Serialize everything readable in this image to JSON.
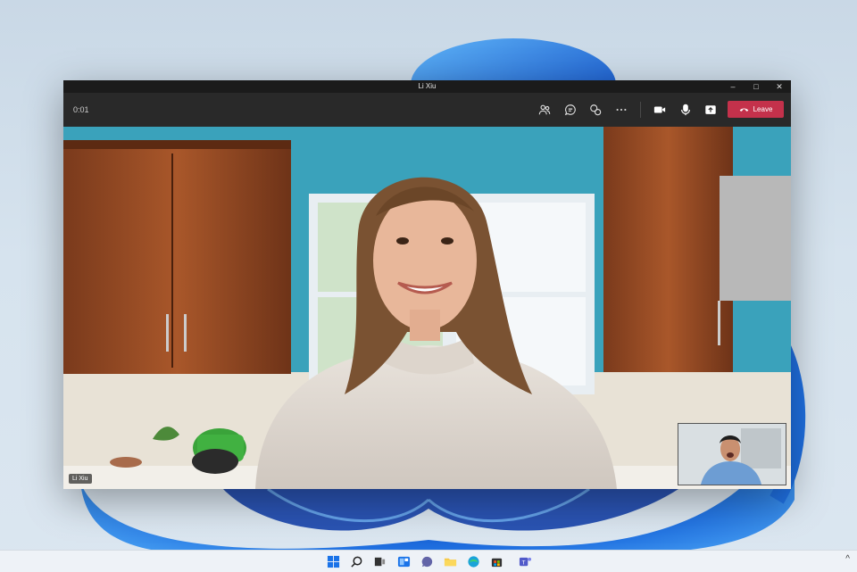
{
  "window": {
    "title": "Li Xiu",
    "minimize_glyph": "–",
    "maximize_glyph": "□",
    "close_glyph": "✕"
  },
  "toolbar": {
    "timer": "0:01",
    "buttons": [
      {
        "name": "participants",
        "icon": "people-icon"
      },
      {
        "name": "chat",
        "icon": "chat-icon"
      },
      {
        "name": "reactions",
        "icon": "reactions-icon"
      },
      {
        "name": "more",
        "icon": "more-icon"
      },
      {
        "name": "camera",
        "icon": "camera-icon"
      },
      {
        "name": "mic",
        "icon": "mic-icon"
      },
      {
        "name": "share",
        "icon": "share-icon"
      }
    ],
    "leave_label": "Leave",
    "leave_color": "#c4314b"
  },
  "call": {
    "participant_name": "Li Xiu"
  },
  "taskbar": {
    "icons": [
      "start-icon",
      "search-icon",
      "task-view-icon",
      "widgets-icon",
      "chat-icon",
      "file-explorer-icon",
      "edge-icon",
      "store-icon",
      "teams-icon"
    ],
    "tray_glyph": "^"
  },
  "colors": {
    "accent_blue": "#1f6fe0",
    "window_bg": "#292929",
    "leave_red": "#c4314b"
  }
}
